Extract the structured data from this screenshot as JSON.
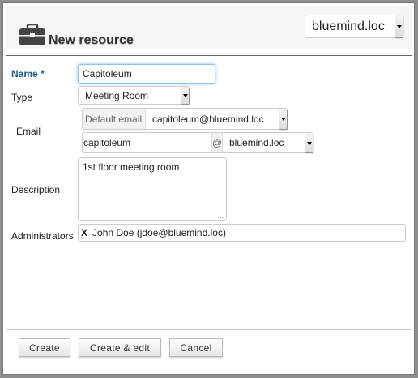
{
  "header": {
    "title": "New resource",
    "icon": "briefcase-icon",
    "domain_select": "bluemind.loc"
  },
  "form": {
    "name_label": "Name",
    "required_mark": "*",
    "name_value": "Capitoleum",
    "type_label": "Type",
    "type_value": "Meeting Room",
    "email_label": "Email",
    "default_email_label": "Default email",
    "default_email_value": "capitoleum@bluemind.loc",
    "email_local": "capitoleum",
    "at": "@",
    "email_domain": "bluemind.loc",
    "description_label": "Description",
    "description_value": "1st floor meeting room",
    "administrators_label": "Administrators",
    "admin_remove": "X",
    "admin_value": "John Doe (jdoe@bluemind.loc)"
  },
  "footer": {
    "create": "Create",
    "create_edit": "Create & edit",
    "cancel": "Cancel"
  },
  "colors": {
    "required_label": "#1e5c8e",
    "focus": "#8ec3ef"
  }
}
